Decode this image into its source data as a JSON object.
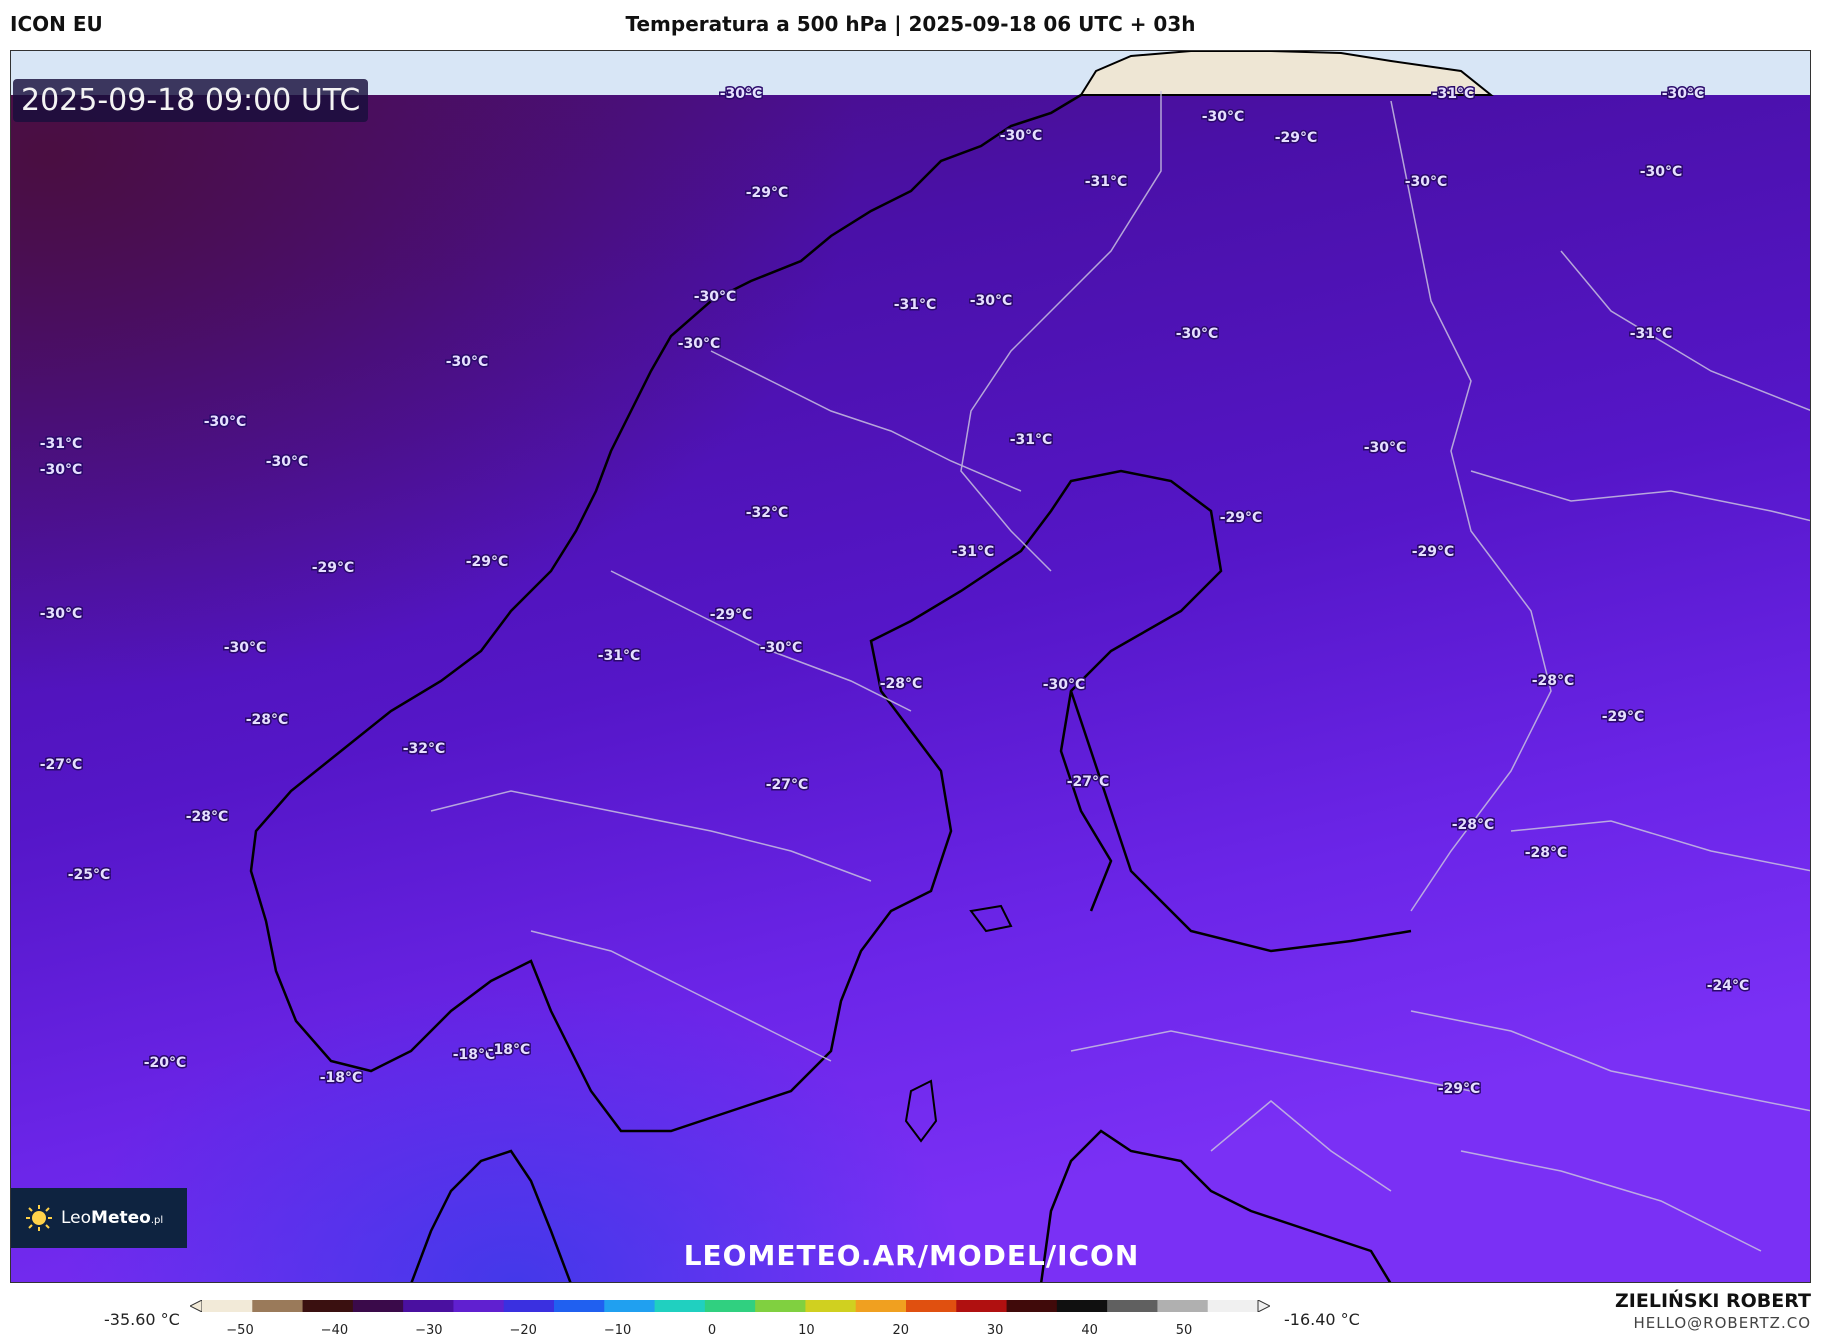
{
  "header": {
    "model": "ICON EU",
    "title": "Temperatura a 500 hPa | 2025-09-18 06 UTC + 03h"
  },
  "map": {
    "valid_time": "2025-09-18 09:00 UTC",
    "watermark": "LEOMETEO.AR/MODEL/ICON",
    "logo": {
      "name_light": "Leo",
      "name_bold": "Meteo",
      "suffix": ".pl"
    },
    "labels": [
      "-30°C",
      "-30°C",
      "-31°C",
      "-30°C",
      "-30°C",
      "-29°C",
      "-31°C",
      "-30°C",
      "-30°C",
      "-29°C",
      "-30°C",
      "-31°C",
      "-30°C",
      "-30°C",
      "-31°C",
      "-30°C",
      "-30°C",
      "-31°C",
      "-31°C",
      "-30°C",
      "-30°C",
      "-30°C",
      "-30°C",
      "-32°C",
      "-31°C",
      "-29°C",
      "-29°C",
      "-29°C",
      "-29°C",
      "-30°C",
      "-29°C",
      "-30°C",
      "-30°C",
      "-31°C",
      "-28°C",
      "-30°C",
      "-28°C",
      "-29°C",
      "-28°C",
      "-32°C",
      "-27°C",
      "-28°C",
      "-27°C",
      "-27°C",
      "-28°C",
      "-28°C",
      "-25°C",
      "-24°C",
      "-20°C",
      "-18°C",
      "-18°C",
      "-18°C",
      "-29°C"
    ]
  },
  "colorbar": {
    "min_label": "-35.60 °C",
    "max_label": "-16.40 °C",
    "ticks": [
      "−50",
      "−40",
      "−30",
      "−20",
      "−10",
      "0",
      "10",
      "20",
      "30",
      "40",
      "50"
    ],
    "colors": [
      "#f2ead8",
      "#9a7a5a",
      "#3a1010",
      "#3a0a4a",
      "#4a10a0",
      "#6020d0",
      "#3a30e0",
      "#2060f0",
      "#20a0f0",
      "#20d0c0",
      "#30d080",
      "#80d040",
      "#d0d020",
      "#f0a020",
      "#e05010",
      "#b01010",
      "#400a0a",
      "#101010",
      "#606060",
      "#b0b0b0",
      "#f0f0f0"
    ]
  },
  "footer": {
    "author": "ZIELIŃSKI ROBERT",
    "email": "HELLO@ROBERTZ.CO"
  }
}
